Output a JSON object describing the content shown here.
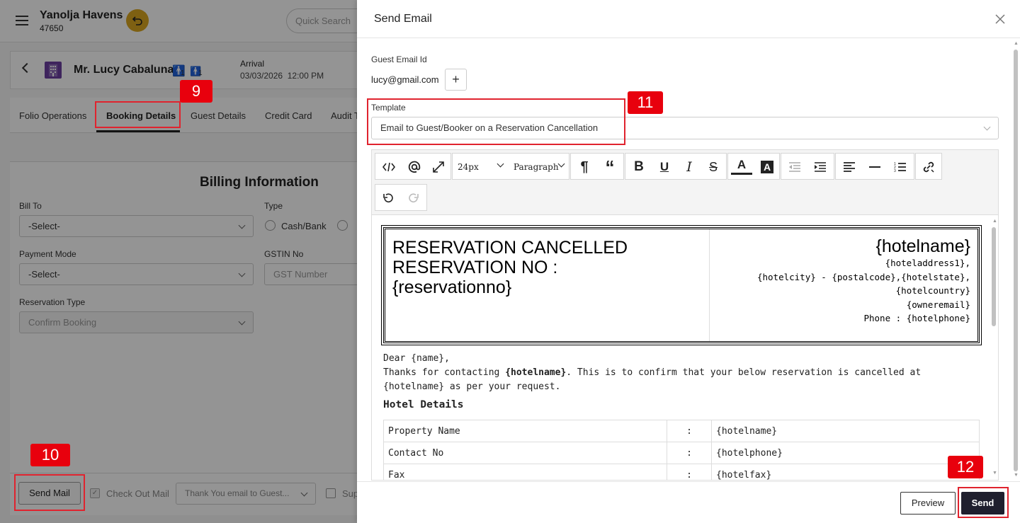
{
  "app": {
    "hotel_name": "Yanolja Havens",
    "hotel_id": "47650",
    "quick_search_placeholder": "Quick Search"
  },
  "guest": {
    "name": "Mr. Lucy Cabaluna",
    "adults": "1",
    "children": "1",
    "arrival_label": "Arrival",
    "arrival_value": "03/03/2026  12:00 PM"
  },
  "tabs": [
    "Folio Operations",
    "Booking Details",
    "Guest Details",
    "Credit Card",
    "Audit T"
  ],
  "billing": {
    "title": "Billing Information",
    "bill_to_label": "Bill To",
    "bill_to_value": "-Select-",
    "type_label": "Type",
    "type_option1": "Cash/Bank",
    "payment_mode_label": "Payment Mode",
    "payment_mode_value": "-Select-",
    "gstin_label": "GSTIN No",
    "gstin_placeholder": "GST Number",
    "reservation_type_label": "Reservation Type",
    "reservation_type_value": "Confirm Booking"
  },
  "footer_bar": {
    "send_mail": "Send Mail",
    "check_out_mail": "Check Out Mail",
    "template_value": "Thank You email to Guest...",
    "sup_label": "Sup"
  },
  "annotations": {
    "b9": "9",
    "b10": "10",
    "b11": "11",
    "b12": "12"
  },
  "modal": {
    "title": "Send Email",
    "guest_email_label": "Guest Email Id",
    "guest_email": "lucy@gmail.com",
    "template_label": "Template",
    "template_value": "Email to Guest/Booker on a Reservation Cancellation",
    "toolbar": {
      "font_size": "24px",
      "block_format": "Paragraph"
    },
    "preview_button": "Preview",
    "send_button": "Send"
  },
  "email_body": {
    "heading_line1": "RESERVATION CANCELLED",
    "heading_line2": "RESERVATION NO :",
    "heading_line3": "{reservationno}",
    "hotelname": "{hotelname}",
    "addr1": "{hoteladdress1},",
    "addr2": "{hotelcity} - {postalcode},{hotelstate},",
    "addr3": "{hotelcountry}",
    "addr4": "{owneremail}",
    "addr5": "Phone : {hotelphone}",
    "dear": "Dear {name},",
    "thanks_pre": "Thanks for contacting ",
    "thanks_bold": "{hotelname}",
    "thanks_post": ". This is to confirm that your below reservation is cancelled at {hotelname} as per your request.",
    "hotel_details_title": "Hotel Details",
    "rows": [
      {
        "label": "Property Name",
        "sep": ":",
        "value": "{hotelname}"
      },
      {
        "label": "Contact No",
        "sep": ":",
        "value": "{hotelphone}"
      },
      {
        "label": "Fax",
        "sep": ":",
        "value": "{hotelfax}"
      }
    ]
  },
  "colors": {
    "accent_dark": "#1f1f2e",
    "annotation_red": "#e0232e",
    "undo_badge": "#d9a520"
  }
}
